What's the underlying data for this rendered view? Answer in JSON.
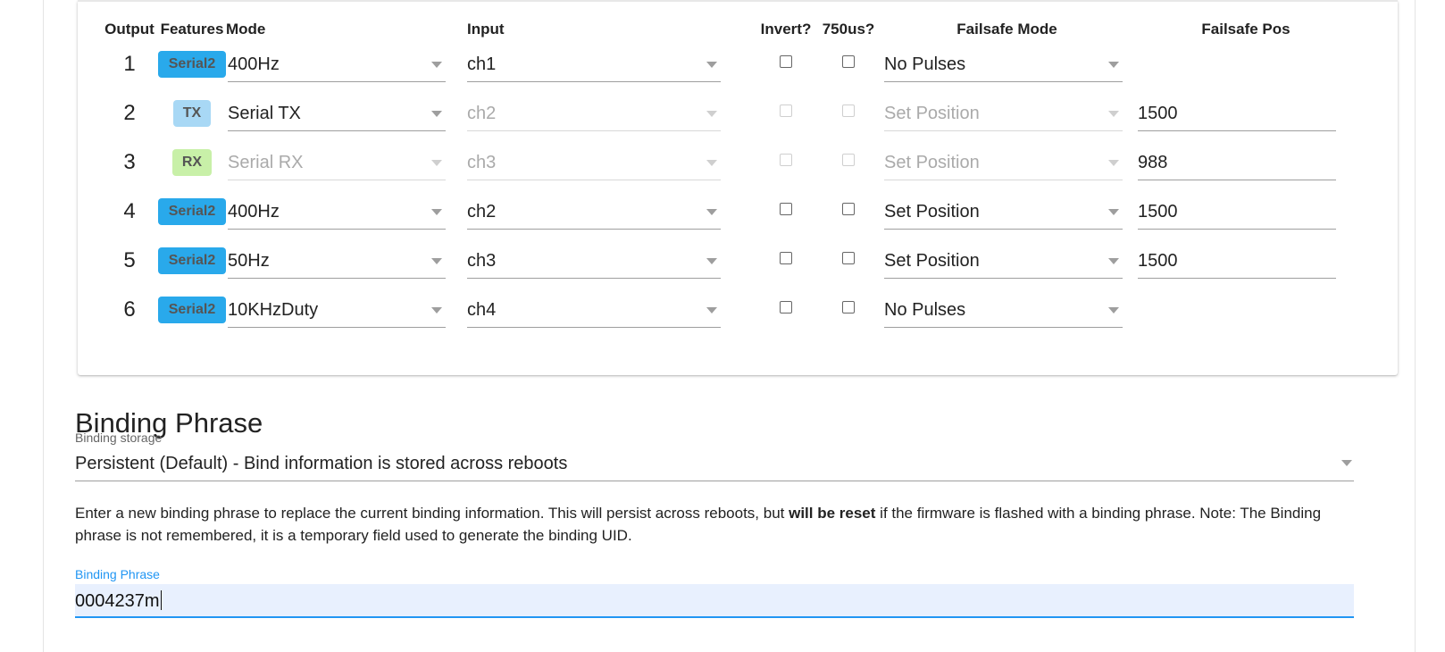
{
  "table": {
    "headers": {
      "output": "Output",
      "features": "Features",
      "mode": "Mode",
      "input": "Input",
      "invert": "Invert?",
      "us750": "750us?",
      "failsafe_mode": "Failsafe Mode",
      "failsafe_pos": "Failsafe Pos"
    },
    "rows": [
      {
        "output": "1",
        "feature": "Serial2",
        "mode": "400Hz",
        "input": "ch1",
        "failsafe_mode": "No Pulses",
        "failsafe_pos": ""
      },
      {
        "output": "2",
        "feature": "TX",
        "mode": "Serial TX",
        "input": "ch2",
        "failsafe_mode": "Set Position",
        "failsafe_pos": "1500"
      },
      {
        "output": "3",
        "feature": "RX",
        "mode": "Serial RX",
        "input": "ch3",
        "failsafe_mode": "Set Position",
        "failsafe_pos": "988"
      },
      {
        "output": "4",
        "feature": "Serial2",
        "mode": "400Hz",
        "input": "ch2",
        "failsafe_mode": "Set Position",
        "failsafe_pos": "1500"
      },
      {
        "output": "5",
        "feature": "Serial2",
        "mode": "50Hz",
        "input": "ch3",
        "failsafe_mode": "Set Position",
        "failsafe_pos": "1500"
      },
      {
        "output": "6",
        "feature": "Serial2",
        "mode": "10KHzDuty",
        "input": "ch4",
        "failsafe_mode": "No Pulses",
        "failsafe_pos": ""
      }
    ]
  },
  "binding": {
    "heading": "Binding Phrase",
    "storage_label": "Binding storage",
    "storage_value": "Persistent (Default) - Bind information is stored across reboots",
    "note_part1": "Enter a new binding phrase to replace the current binding information. This will persist across reboots, but ",
    "note_bold": "will be reset",
    "note_part2": " if the firmware is flashed with a binding phrase. Note: The Binding phrase is not remembered, it is a temporary field used to generate the binding UID.",
    "phrase_label": "Binding Phrase",
    "phrase_value": "0004237m"
  },
  "colors": {
    "serial_badge": "#29a9eb",
    "tx_badge": "#a8d8f5",
    "rx_badge": "#c8f0a8",
    "focus_accent": "#2196f3",
    "input_fill": "#e8f0fe"
  }
}
